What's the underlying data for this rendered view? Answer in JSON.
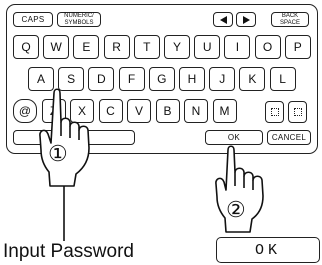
{
  "keyboard": {
    "function_keys": {
      "caps": "CAPS",
      "numeric_line1": "NUMERIC/",
      "numeric_line2": "SYMBOLS",
      "back_line1": "BACK",
      "back_line2": "SPACE"
    },
    "row1": [
      "Q",
      "W",
      "E",
      "R",
      "T",
      "Y",
      "U",
      "I",
      "O",
      "P"
    ],
    "row2": [
      "A",
      "S",
      "D",
      "F",
      "G",
      "H",
      "J",
      "K",
      "L"
    ],
    "row3": [
      "@",
      "Z",
      "X",
      "C",
      "V",
      "B",
      "N",
      "M"
    ],
    "space_fragment": "E",
    "ok": "OK",
    "cancel": "CANCEL"
  },
  "steps": {
    "step1": "①",
    "step2": "②"
  },
  "caption": "Input Password",
  "display_value": "OK"
}
